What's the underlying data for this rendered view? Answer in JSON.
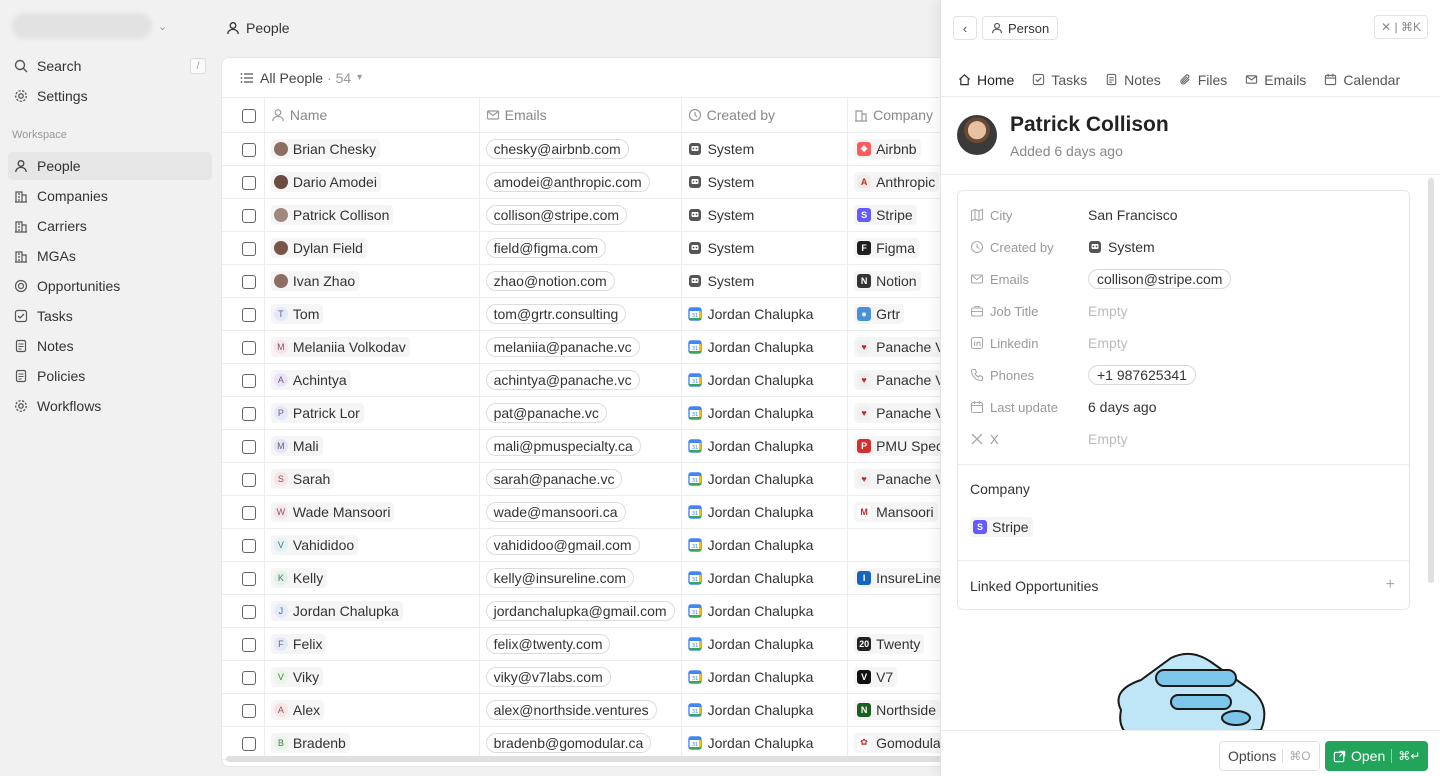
{
  "sidebar": {
    "search_label": "Search",
    "search_kbd": "/",
    "settings_label": "Settings",
    "workspace_label": "Workspace",
    "items": [
      {
        "label": "People"
      },
      {
        "label": "Companies"
      },
      {
        "label": "Carriers"
      },
      {
        "label": "MGAs"
      },
      {
        "label": "Opportunities"
      },
      {
        "label": "Tasks"
      },
      {
        "label": "Notes"
      },
      {
        "label": "Policies"
      },
      {
        "label": "Workflows"
      }
    ]
  },
  "topbar": {
    "title": "People"
  },
  "view": {
    "name": "All People",
    "count": "· 54"
  },
  "table": {
    "headers": {
      "name": "Name",
      "emails": "Emails",
      "created_by": "Created by",
      "company": "Company"
    },
    "rows": [
      {
        "name": "Brian Chesky",
        "email": "chesky@airbnb.com",
        "created_by": "System",
        "company": "Airbnb",
        "initial": "",
        "avcolor": "#8d6e63",
        "cocolor": "#ff5a5f",
        "coglyph": "◆"
      },
      {
        "name": "Dario Amodei",
        "email": "amodei@anthropic.com",
        "created_by": "System",
        "company": "Anthropic",
        "initial": "",
        "avcolor": "#6d4c41",
        "cocolor": "#f0ede6",
        "coglyph": "A"
      },
      {
        "name": "Patrick Collison",
        "email": "collison@stripe.com",
        "created_by": "System",
        "company": "Stripe",
        "initial": "",
        "avcolor": "#a1887f",
        "cocolor": "#635bff",
        "coglyph": "S"
      },
      {
        "name": "Dylan Field",
        "email": "field@figma.com",
        "created_by": "System",
        "company": "Figma",
        "initial": "",
        "avcolor": "#795548",
        "cocolor": "#1e1e1e",
        "coglyph": "F"
      },
      {
        "name": "Ivan Zhao",
        "email": "zhao@notion.com",
        "created_by": "System",
        "company": "Notion",
        "initial": "",
        "avcolor": "#8d6e63",
        "cocolor": "#333333",
        "coglyph": "N"
      },
      {
        "name": "Tom",
        "email": "tom@grtr.consulting",
        "created_by": "Jordan Chalupka",
        "company": "Grtr",
        "initial": "T",
        "avcolor": "#e3e8fb",
        "cocolor": "#4a90d9",
        "coglyph": "●"
      },
      {
        "name": "Melaniia Volkodav",
        "email": "melaniia@panache.vc",
        "created_by": "Jordan Chalupka",
        "company": "Panache V",
        "initial": "M",
        "avcolor": "#fbe3ec",
        "cocolor": "#f0f0f0",
        "coglyph": "♥"
      },
      {
        "name": "Achintya",
        "email": "achintya@panache.vc",
        "created_by": "Jordan Chalupka",
        "company": "Panache V",
        "initial": "A",
        "avcolor": "#ece3fb",
        "cocolor": "#f0f0f0",
        "coglyph": "♥"
      },
      {
        "name": "Patrick Lor",
        "email": "pat@panache.vc",
        "created_by": "Jordan Chalupka",
        "company": "Panache V",
        "initial": "P",
        "avcolor": "#e3e8fb",
        "cocolor": "#f0f0f0",
        "coglyph": "♥"
      },
      {
        "name": "Mali",
        "email": "mali@pmuspecialty.ca",
        "created_by": "Jordan Chalupka",
        "company": "PMU Spec",
        "initial": "M",
        "avcolor": "#e3e3fb",
        "cocolor": "#d32f2f",
        "coglyph": "P"
      },
      {
        "name": "Sarah",
        "email": "sarah@panache.vc",
        "created_by": "Jordan Chalupka",
        "company": "Panache V",
        "initial": "S",
        "avcolor": "#fbe3e3",
        "cocolor": "#f0f0f0",
        "coglyph": "♥"
      },
      {
        "name": "Wade Mansoori",
        "email": "wade@mansoori.ca",
        "created_by": "Jordan Chalupka",
        "company": "Mansoori",
        "initial": "W",
        "avcolor": "#fbe3e8",
        "cocolor": "#ffffff",
        "coglyph": "M"
      },
      {
        "name": "Vahididoo",
        "email": "vahididoo@gmail.com",
        "created_by": "Jordan Chalupka",
        "company": "",
        "initial": "V",
        "avcolor": "#dff3f7",
        "cocolor": "",
        "coglyph": ""
      },
      {
        "name": "Kelly",
        "email": "kelly@insureline.com",
        "created_by": "Jordan Chalupka",
        "company": "InsureLine",
        "initial": "K",
        "avcolor": "#def5e6",
        "cocolor": "#1565c0",
        "coglyph": "I"
      },
      {
        "name": "Jordan Chalupka",
        "email": "jordanchalupka@gmail.com",
        "created_by": "Jordan Chalupka",
        "company": "",
        "initial": "J",
        "avcolor": "#e3ecfb",
        "cocolor": "",
        "coglyph": ""
      },
      {
        "name": "Felix",
        "email": "felix@twenty.com",
        "created_by": "Jordan Chalupka",
        "company": "Twenty",
        "initial": "F",
        "avcolor": "#e3e8fb",
        "cocolor": "#222222",
        "coglyph": "20"
      },
      {
        "name": "Viky",
        "email": "viky@v7labs.com",
        "created_by": "Jordan Chalupka",
        "company": "V7",
        "initial": "V",
        "avcolor": "#e6f7e3",
        "cocolor": "#111111",
        "coglyph": "V"
      },
      {
        "name": "Alex",
        "email": "alex@northside.ventures",
        "created_by": "Jordan Chalupka",
        "company": "Northside",
        "initial": "A",
        "avcolor": "#fbe3e3",
        "cocolor": "#1b5e20",
        "coglyph": "N"
      },
      {
        "name": "Bradenb",
        "email": "bradenb@gomodular.ca",
        "created_by": "Jordan Chalupka",
        "company": "Gomodular",
        "initial": "B",
        "avcolor": "#e3f5e6",
        "cocolor": "#ffffff",
        "coglyph": "✿"
      }
    ]
  },
  "panel": {
    "breadcrumb": "Person",
    "close_kbd": "✕ | ⌘K",
    "tabs": [
      {
        "label": "Home"
      },
      {
        "label": "Tasks"
      },
      {
        "label": "Notes"
      },
      {
        "label": "Files"
      },
      {
        "label": "Emails"
      },
      {
        "label": "Calendar"
      }
    ],
    "name": "Patrick Collison",
    "added": "Added 6 days ago",
    "fields": {
      "city": {
        "label": "City",
        "value": "San Francisco"
      },
      "created_by": {
        "label": "Created by",
        "value": "System"
      },
      "emails": {
        "label": "Emails",
        "value": "collison@stripe.com"
      },
      "job_title": {
        "label": "Job Title",
        "value": "Empty"
      },
      "linkedin": {
        "label": "Linkedin",
        "value": "Empty"
      },
      "phones": {
        "label": "Phones",
        "value": "+1 987625341"
      },
      "last_update": {
        "label": "Last update",
        "value": "6 days ago"
      },
      "x": {
        "label": "X",
        "value": "Empty"
      }
    },
    "company_title": "Company",
    "company_name": "Stripe",
    "linked_title": "Linked Opportunities",
    "options_label": "Options",
    "options_kbd": "⌘O",
    "open_label": "Open",
    "open_kbd": "⌘↵"
  },
  "colors": {
    "accent_green": "#22a55b",
    "stripe": "#635bff"
  }
}
